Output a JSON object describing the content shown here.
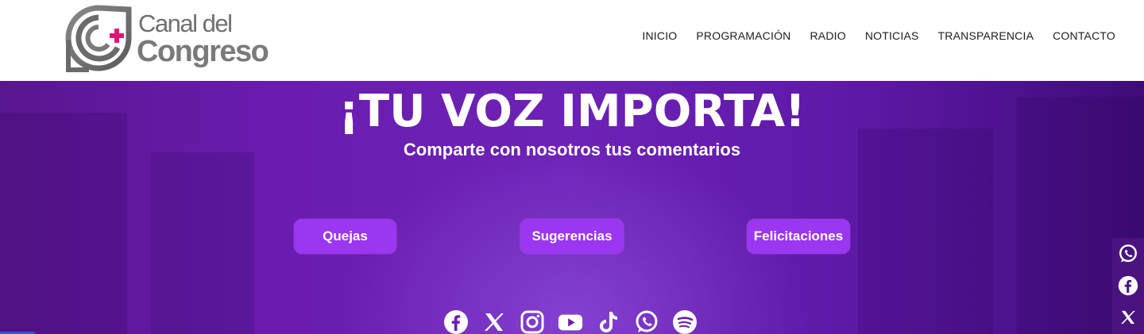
{
  "logo": {
    "line1": "Canal del",
    "line2": "Congreso"
  },
  "nav": [
    {
      "label": "INICIO"
    },
    {
      "label": "PROGRAMACIÓN"
    },
    {
      "label": "RADIO"
    },
    {
      "label": "NOTICIAS"
    },
    {
      "label": "TRANSPARENCIA"
    },
    {
      "label": "CONTACTO"
    }
  ],
  "hero": {
    "title": "¡TU VOZ IMPORTA!",
    "subtitle": "Comparte con nosotros tus comentarios",
    "buttons": [
      {
        "label": "Quejas"
      },
      {
        "label": "Sugerencias"
      },
      {
        "label": "Felicitaciones"
      }
    ]
  },
  "social_icons": [
    "facebook-icon",
    "x-icon",
    "instagram-icon",
    "youtube-icon",
    "tiktok-icon",
    "whatsapp-icon",
    "spotify-icon"
  ],
  "side_icons": [
    "whatsapp-icon",
    "facebook-icon",
    "x-icon"
  ],
  "colors": {
    "accent": "#9b37f0",
    "hero_bg": "#6a1cb0",
    "logo_pink": "#e0157a"
  }
}
